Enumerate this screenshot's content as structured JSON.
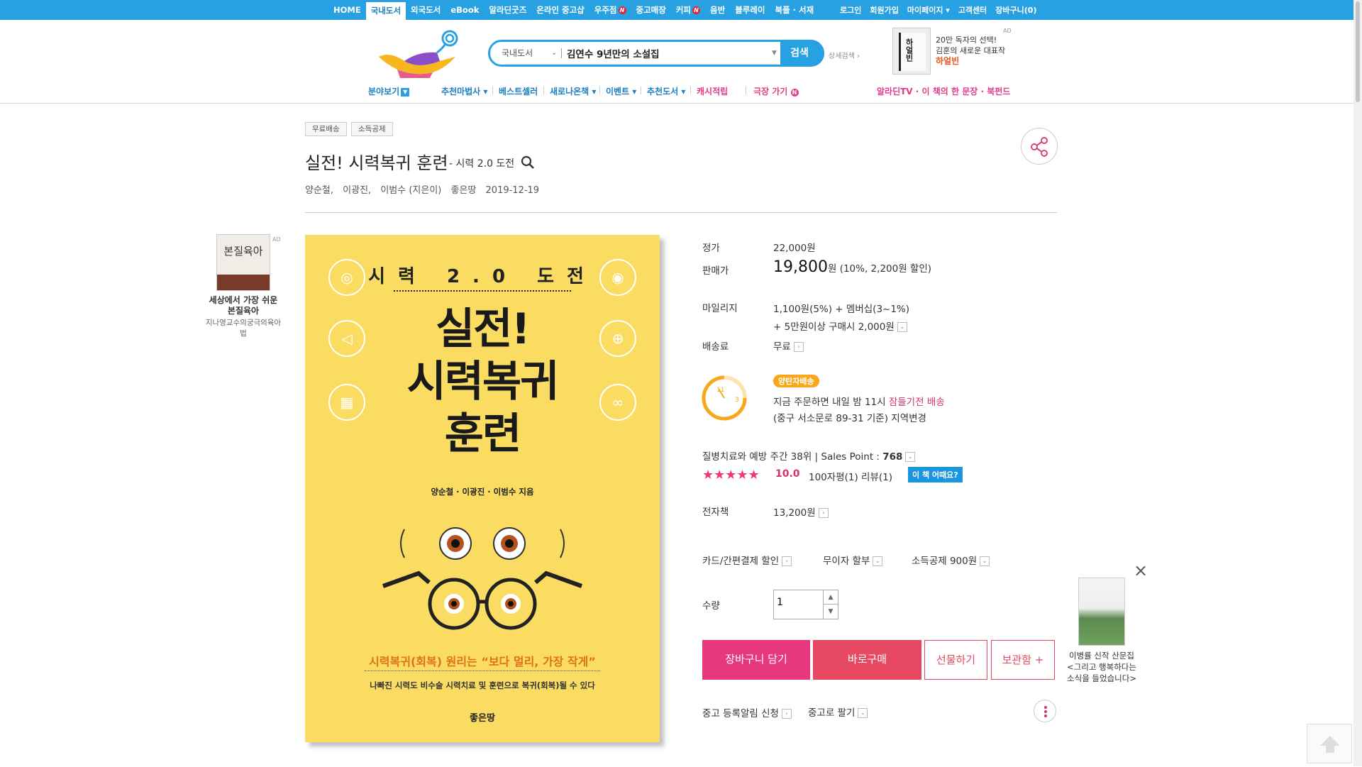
{
  "topnav": {
    "items": [
      "HOME",
      "국내도서",
      "외국도서",
      "eBook",
      "알라딘굿즈",
      "온라인 중고샵",
      "우주점",
      "중고매장",
      "커피",
      "음반",
      "블루레이",
      "북플 · 서재"
    ],
    "active": "국내도서",
    "new_badge": "N",
    "util": [
      "로그인",
      "회원가입",
      "마이페이지 ▾",
      "고객센터",
      "장바구니(0)"
    ]
  },
  "search": {
    "category": "국내도서",
    "value": "김연수 9년만의 소설집",
    "button": "검색",
    "advanced": "상세검색 ›"
  },
  "header_ad": {
    "book_title": "하얼빈",
    "line1": "20만 독자의 선택!",
    "line2": "김훈의 새로운 대표작",
    "line3": "하얼빈",
    "ad": "AD"
  },
  "catnav": {
    "browse": "분야보기",
    "items": [
      "추천마법사 ▾",
      "베스트셀러",
      "새로나온책 ▾",
      "이벤트 ▾",
      "추천도서 ▾"
    ],
    "pink_items": [
      "캐시적립",
      "극장 가기"
    ],
    "right": "알라딘TV · 이 책의 한 문장 · 북펀드"
  },
  "badges": [
    "무료배송",
    "소득공제"
  ],
  "book": {
    "title": "실전! 시력복귀 훈련",
    "subtitle": "- 시력 2.0 도전",
    "authors": [
      "양순철,",
      "이광진,",
      "이범수 (지은이)",
      "좋은땅",
      "2019-12-19"
    ]
  },
  "side_ad": {
    "book_title": "본질육아",
    "line1": "세상에서 가장 쉬운",
    "line2": "본질육아",
    "line3": "지나영교수의궁극의육아법",
    "ad": "AD"
  },
  "cover": {
    "top": "시력 2.0 도전",
    "main1": "실전!",
    "main2": "시력복귀",
    "main3": "훈련",
    "authors": "양순철 · 이광진 · 이범수 지음",
    "slogan": "시력복귀(회복) 원리는 “보다 멀리, 가장 작게”",
    "sub": "나빠진 시력도 비수술 시력치료 및 훈련으로 복귀(회복)될 수 있다",
    "publisher": "좋은땅"
  },
  "info": {
    "list_label": "정가",
    "list_price": "22,000원",
    "sale_label": "판매가",
    "sale_price": "19,800",
    "sale_unit": "원",
    "sale_disc": "(10%, 2,200원 할인)",
    "mileage_label": "마일리지",
    "mileage1": "1,100원(5%) + 멤버십(3~1%)",
    "mileage2": "+ 5만원이상 구매시 2,000원",
    "ship_label": "배송료",
    "ship_value": "무료",
    "delivery_badge": "양탄자배송",
    "delivery1_a": "지금 주문하면 내일 밤 11시 ",
    "delivery1_b": "잠들기전 배송",
    "delivery2": "(중구 서소문로 89-31 기준) 지역변경",
    "rank": "질병치료와 예방 주간 38위  |  Sales Point : ",
    "sales_point": "768",
    "stars": "★★★★★",
    "score": "10.0",
    "reviews": "100자평(1)   리뷰(1)",
    "how_book": "이 책 어때요?",
    "ebook_label": "전자책",
    "ebook_price": "13,200원",
    "card_disc": "카드/간편결제 할인",
    "installment": "무이자 할부",
    "tax_deduct": "소득공제 900원",
    "qty_label": "수량",
    "qty": "1",
    "used_notify": "중고 등록알림 신청",
    "used_sell": "중고로 팔기"
  },
  "buttons": {
    "cart": "장바구니 담기",
    "buy": "바로구매",
    "gift": "선물하기",
    "keep": "보관함 +"
  },
  "right_ad": {
    "line1": "이병률 신작 산문집",
    "line2": "<그리고 행복하다는",
    "line3": "소식을 들었습니다>"
  },
  "colors": {
    "brand": "#27a1e2",
    "pink": "#e8387d",
    "cover": "#fbdc63"
  }
}
